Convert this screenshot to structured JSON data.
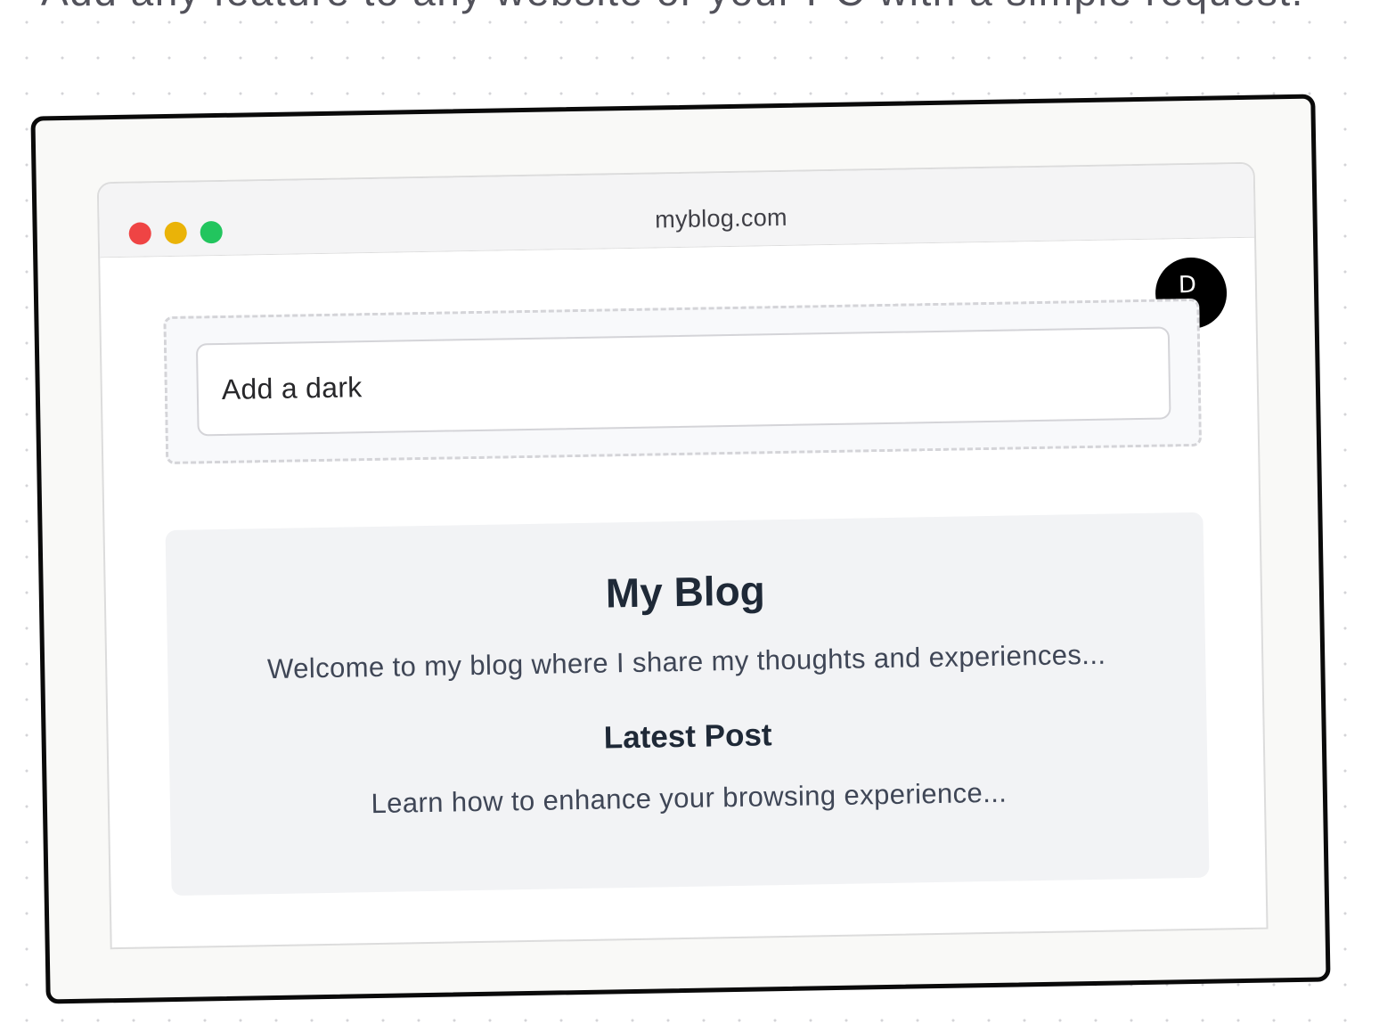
{
  "headline": "Add any feature to any website or your PC with a simple request.",
  "browser": {
    "url": "myblog.com",
    "traffic_lights": {
      "close_color": "#ef4444",
      "minimize_color": "#eab308",
      "maximize_color": "#22c55e"
    }
  },
  "assistant_button": {
    "icon": "d-logo-icon",
    "glyph": "D",
    "background_color": "#000000"
  },
  "prompt": {
    "value": "Add a dark"
  },
  "blog": {
    "title": "My Blog",
    "intro": "Welcome to my blog where I share my thoughts and experiences...",
    "latest_heading": "Latest Post",
    "latest_excerpt": "Learn how to enhance your browsing experience..."
  }
}
